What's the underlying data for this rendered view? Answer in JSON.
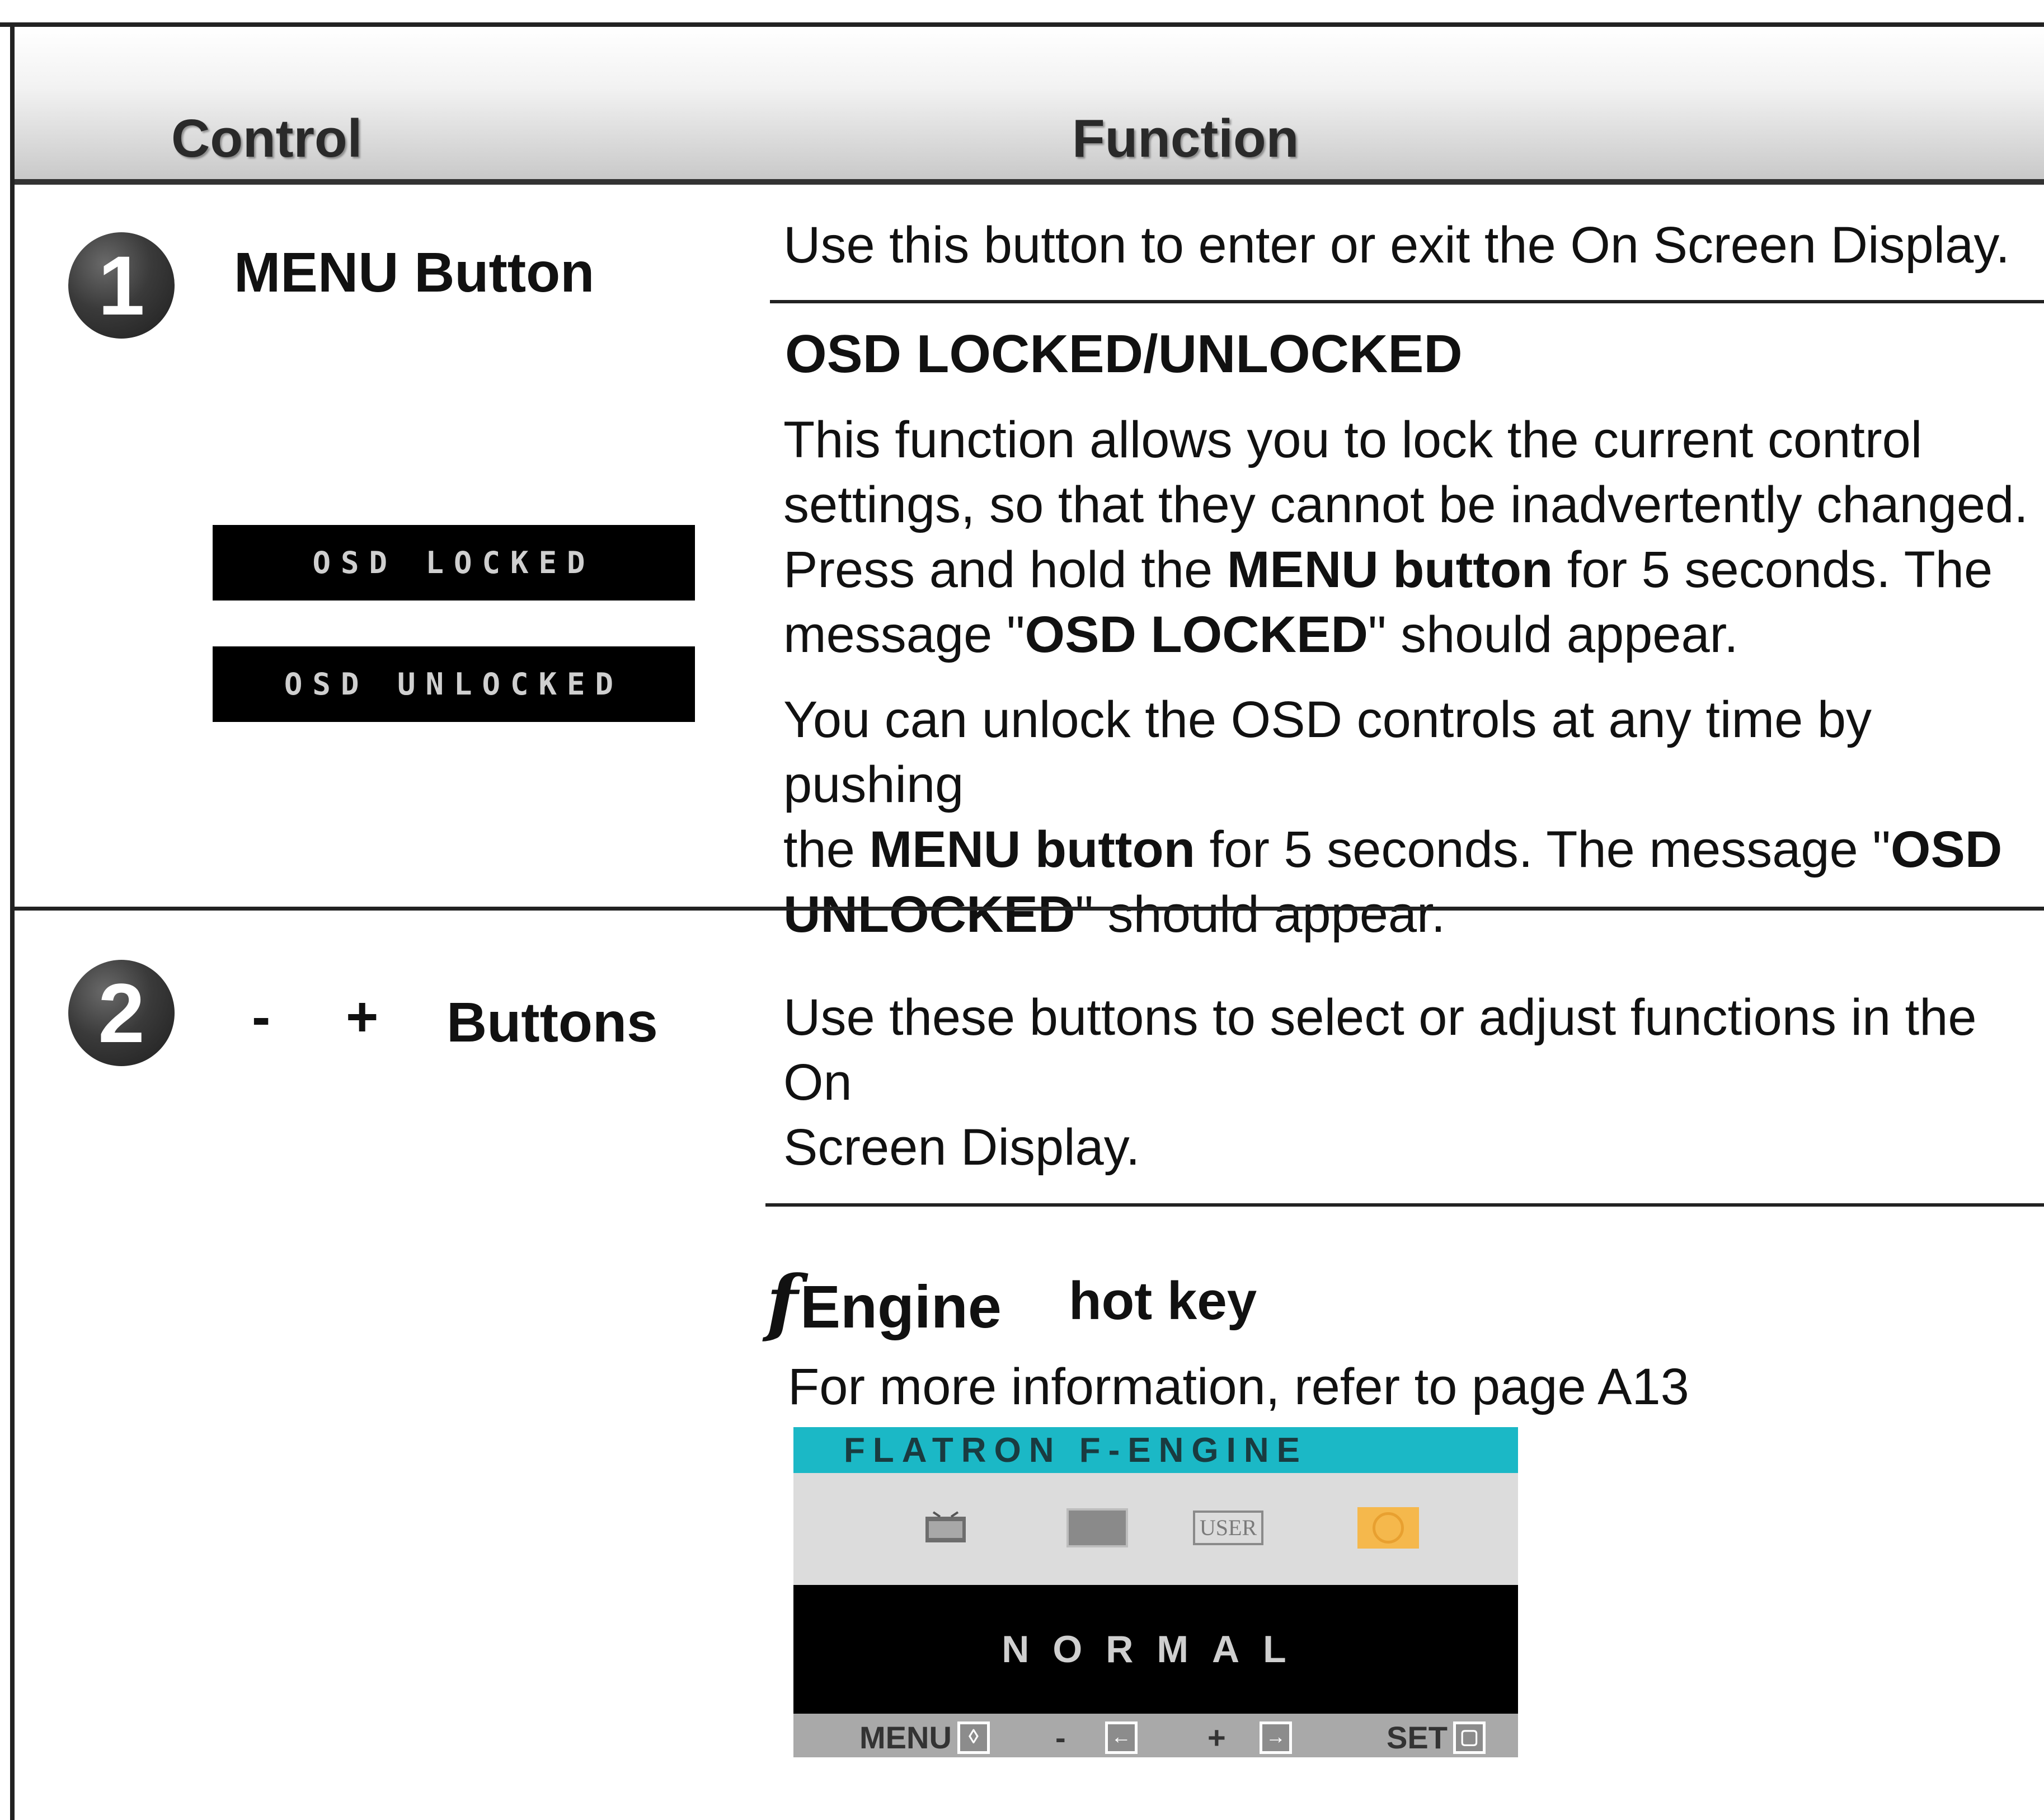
{
  "header": {
    "control": "Control",
    "function": "Function"
  },
  "rows": [
    {
      "number": "1",
      "control_label": "MENU Button",
      "osd_badges": [
        "OSD LOCKED",
        "OSD UNLOCKED"
      ],
      "desc": "Use this button to enter or exit the On Screen Display.",
      "sub_heading": "OSD LOCKED/UNLOCKED",
      "para1": {
        "l1": "This function allows you to lock the current control",
        "l2": "settings, so that they cannot be inadvertently changed.",
        "l3a": "Press and hold the ",
        "l3b": "MENU button",
        "l3c": " for 5 seconds. The",
        "l4a": "message \"",
        "l4b": "OSD LOCKED",
        "l4c": "\" should appear."
      },
      "para2": {
        "l1": "You can unlock the OSD controls at any time by pushing",
        "l2a": "the ",
        "l2b": "MENU button",
        "l2c": " for 5 seconds. The message \"",
        "l2d": "OSD",
        "l3a": "UNLOCKED",
        "l3b": "\" should appear."
      }
    },
    {
      "number": "2",
      "control_minus": "-",
      "control_plus": "+",
      "control_label": "Buttons",
      "desc_l1": "Use these buttons to select or adjust functions in the On",
      "desc_l2": "Screen Display.",
      "f_engine": {
        "mark": "f",
        "word": "Engine",
        "hotkey": "hot key"
      },
      "more_info": "For more information, refer to page A13",
      "osd": {
        "title": "FLATRON F-ENGINE",
        "icons": [
          "movie-icon",
          "text-icon",
          "user-icon",
          "normal-icon"
        ],
        "user_label": "USER",
        "mode": "NORMAL",
        "bar": {
          "menu": "MENU",
          "minus": "-",
          "plus": "+",
          "set": "SET"
        }
      }
    }
  ]
}
